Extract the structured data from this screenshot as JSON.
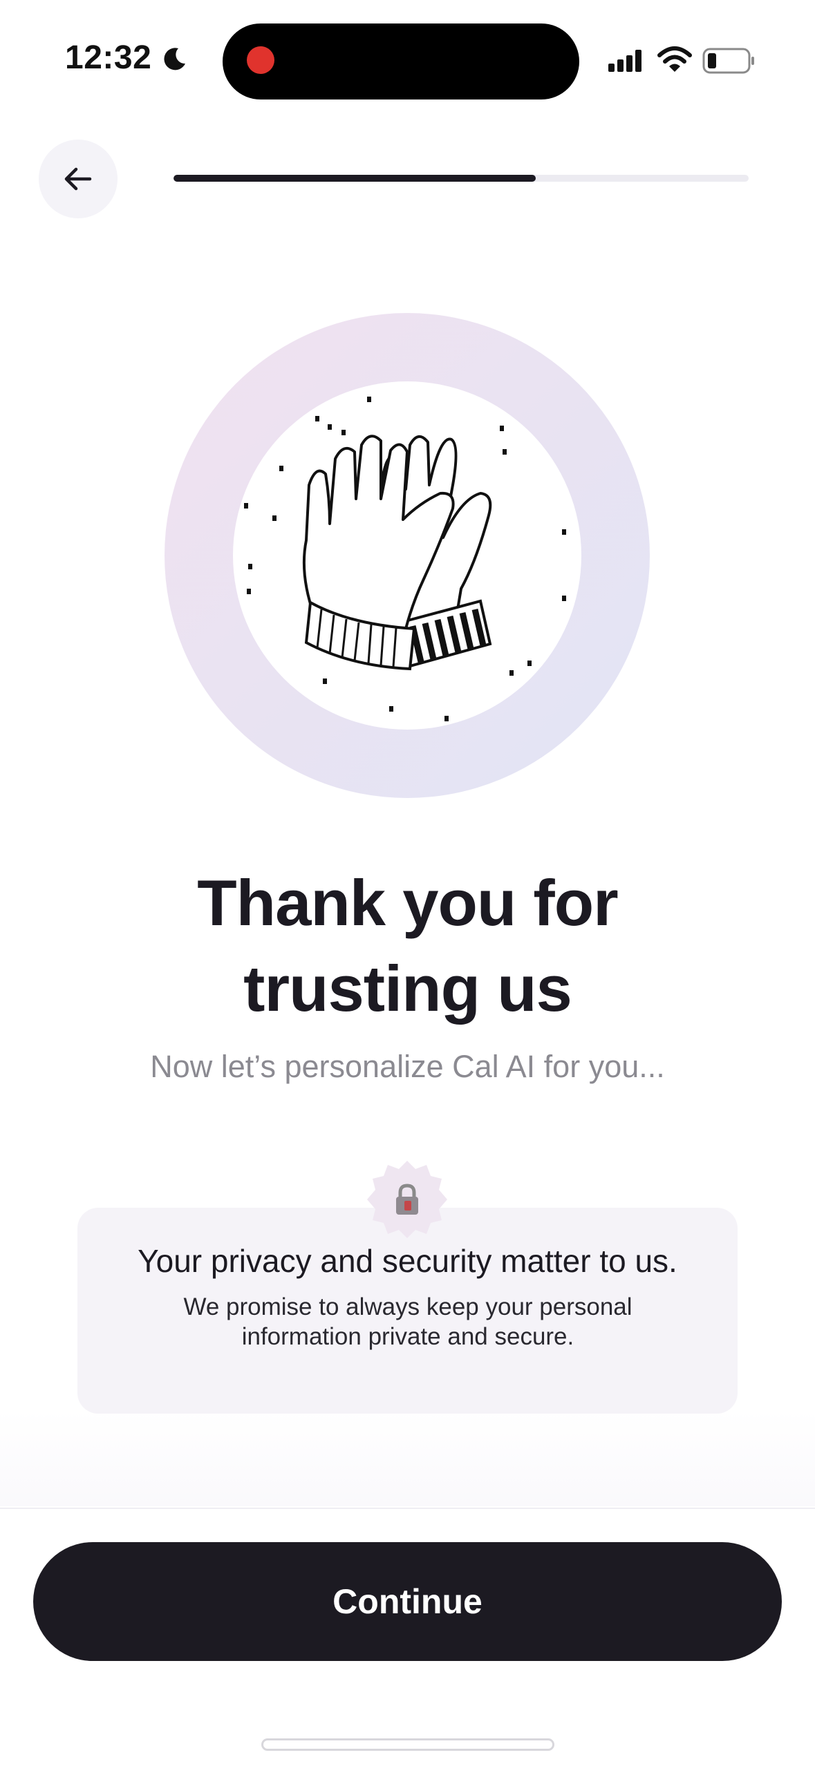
{
  "status_bar": {
    "time": "12:32",
    "icons": [
      "moon-icon",
      "signal-icon",
      "wifi-icon",
      "battery-icon"
    ]
  },
  "header": {
    "back_icon": "arrow-left-icon",
    "progress": 0.63
  },
  "illustration": {
    "name": "high-five-gloves-illustration"
  },
  "content": {
    "title_line1": "Thank you for",
    "title_line2": "trusting us",
    "subtitle": "Now let’s personalize Cal AI for you..."
  },
  "privacy": {
    "icon": "lock-badge-icon",
    "title": "Your privacy and security matter to us.",
    "text": "We promise to always keep your personal information private and secure."
  },
  "footer": {
    "continue_label": "Continue"
  },
  "colors": {
    "primary": "#1c1a22",
    "recording": "#e0332d",
    "muted_text": "#8b8a91",
    "card_bg": "#f5f3f8"
  }
}
